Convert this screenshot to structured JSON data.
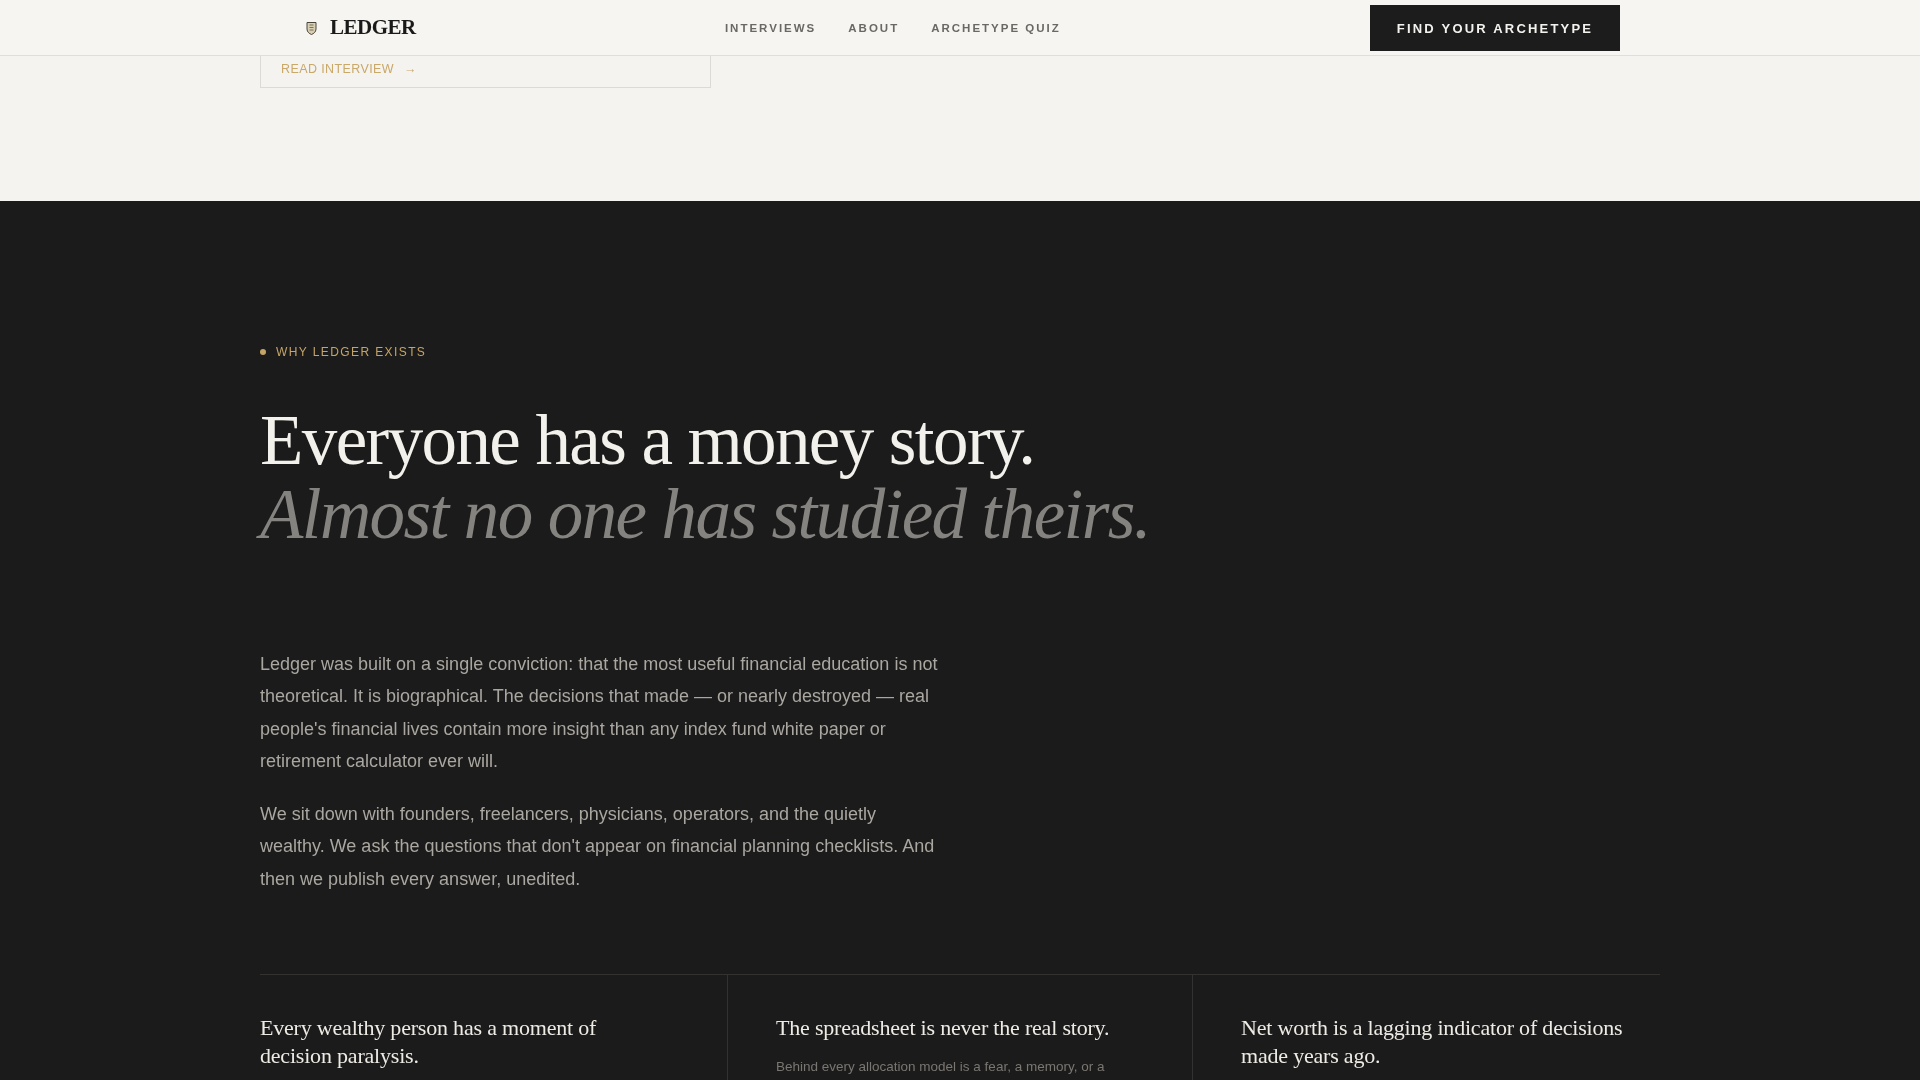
{
  "header": {
    "logo": "LEDGER",
    "nav": [
      {
        "label": "INTERVIEWS"
      },
      {
        "label": "ABOUT"
      },
      {
        "label": "ARCHETYPE QUIZ"
      }
    ],
    "cta": "FIND YOUR ARCHETYPE"
  },
  "interview_card": {
    "link": "READ INTERVIEW",
    "arrow": "→"
  },
  "about": {
    "eyebrow": "WHY LEDGER EXISTS",
    "headline": "Everyone has a money story.",
    "headline_italic": "Almost no one has studied theirs.",
    "paragraphs": [
      "Ledger was built on a single conviction: that the most useful financial education is not theoretical. It is biographical. The decisions that made — or nearly destroyed — real people's financial lives contain more insight than any index fund white paper or retirement calculator ever will.",
      "We sit down with founders, freelancers, physicians, operators, and the quietly wealthy. We ask the questions that don't appear on financial planning checklists. And then we publish every answer, unedited."
    ],
    "principles": [
      {
        "title": "Every wealthy person has a moment of decision paralysis."
      },
      {
        "title": "The spreadsheet is never the real story.",
        "text": "Behind every allocation model is a fear, a memory, or a"
      },
      {
        "title": "Net worth is a lagging indicator of decisions made years ago."
      }
    ]
  }
}
